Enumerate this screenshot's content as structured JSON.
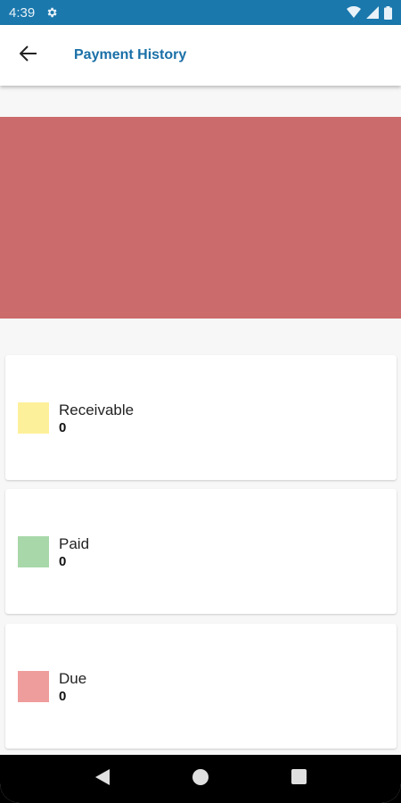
{
  "status_bar": {
    "time": "4:39",
    "icons": [
      "settings-gear-icon",
      "wifi-icon",
      "signal-icon",
      "battery-icon"
    ],
    "color": "#1a78ad"
  },
  "app_bar": {
    "back_icon": "arrow-back-icon",
    "title": "Payment History",
    "title_color": "#1a6fa7"
  },
  "chart": {
    "color": "#cc6b6b"
  },
  "legend": [
    {
      "label": "Receivable",
      "value": "0",
      "color": "#fdf09b"
    },
    {
      "label": "Paid",
      "value": "0",
      "color": "#a8d8a9"
    },
    {
      "label": "Due",
      "value": "0",
      "color": "#ef9c9c"
    }
  ],
  "nav_bar": {
    "icons": [
      "back-triangle-icon",
      "home-circle-icon",
      "recents-square-icon"
    ]
  }
}
